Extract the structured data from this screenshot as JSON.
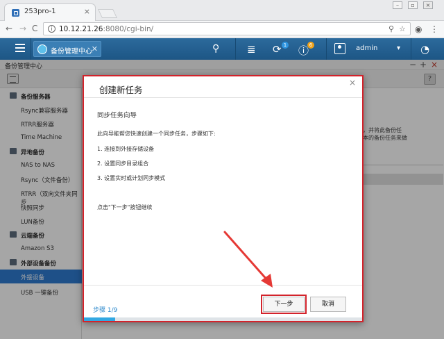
{
  "browser": {
    "tab_title": "253pro-1",
    "tab_close": "×",
    "url_host": "10.12.21.26",
    "url_rest": ":8080/cgi-bin/",
    "nav_back": "←",
    "nav_forward": "→",
    "nav_reload": "C"
  },
  "qts": {
    "app_tab_label": "备份管理中心",
    "app_tab_close": "✕",
    "user_name": "admin",
    "badge_sync": "1",
    "badge_info": "6",
    "colors": {
      "topbar": "#235f90",
      "selected": "#2f7bd1",
      "highlight": "#d3232b",
      "progress": "#32a8e2"
    }
  },
  "app": {
    "header_title": "备份管理中心",
    "win_controls": [
      "−",
      "+",
      "×"
    ],
    "help": "?"
  },
  "sidebar": {
    "sections": [
      {
        "label": "备份服务器",
        "items": [
          "Rsync兼容服务器",
          "RTRR服务器",
          "Time Machine"
        ]
      },
      {
        "label": "异地备份",
        "items": [
          "NAS to NAS",
          "Rsync（文件备份）",
          "RTRR（双向文件夹同步",
          "快照同步",
          "LUN备份"
        ]
      },
      {
        "label": "云端备份",
        "items": [
          "Amazon S3"
        ]
      },
      {
        "label": "外部设备备份",
        "items": [
          "外接设备",
          "USB 一键备份"
        ]
      }
    ],
    "selected": "外接设备"
  },
  "background_text": {
    "line1": "子，并将此备份任",
    "line2": "对本的备份任务来做"
  },
  "modal": {
    "title": "创建新任务",
    "close": "×",
    "subtitle": "同步任务向导",
    "intro": "此向导能帮您快速创建一个同步任务，步骤如下:",
    "steps": [
      "1. 连接到外接存储设备",
      "2. 设置同步目录组合",
      "3. 设置实时或计划同步模式"
    ],
    "hint": "点击\"下一步\"按钮继续",
    "step_indicator": "步骤 1/9",
    "progress_fraction": 0.111,
    "next_button": "下一步",
    "cancel_button": "取消"
  }
}
